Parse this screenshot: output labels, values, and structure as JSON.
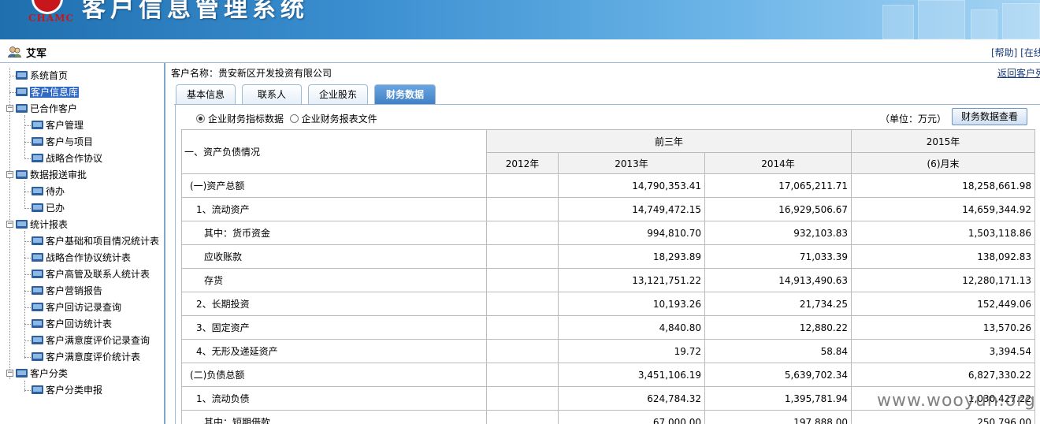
{
  "header": {
    "logo_text": "CHAMC",
    "system_title": "客户信息管理系统"
  },
  "userbar": {
    "user_name": "艾军",
    "links_text": "[帮助] [在线"
  },
  "sidebar": {
    "items": [
      {
        "label": "系统首页"
      },
      {
        "label": "客户信息库"
      },
      {
        "label": "已合作客户"
      },
      {
        "label": "客户管理"
      },
      {
        "label": "客户与项目"
      },
      {
        "label": "战略合作协议"
      },
      {
        "label": "数据报送审批"
      },
      {
        "label": "待办"
      },
      {
        "label": "已办"
      },
      {
        "label": "统计报表"
      },
      {
        "label": "客户基础和项目情况统计表"
      },
      {
        "label": "战略合作协议统计表"
      },
      {
        "label": "客户高管及联系人统计表"
      },
      {
        "label": "客户营销报告"
      },
      {
        "label": "客户回访记录查询"
      },
      {
        "label": "客户回访统计表"
      },
      {
        "label": "客户满意度评价记录查询"
      },
      {
        "label": "客户满意度评价统计表"
      },
      {
        "label": "客户分类"
      },
      {
        "label": "客户分类申报"
      }
    ]
  },
  "main": {
    "customer_label": "客户名称：贵安新区开发投资有限公司",
    "back_link": "返回客户列",
    "tabs": [
      {
        "label": "基本信息"
      },
      {
        "label": "联系人"
      },
      {
        "label": "企业股东"
      },
      {
        "label": "财务数据"
      }
    ],
    "radios": [
      {
        "label": "企业财务指标数据",
        "checked": true
      },
      {
        "label": "企业财务报表文件",
        "checked": false
      }
    ],
    "unit_text": "（单位：万元）",
    "view_button": "财务数据查看",
    "table": {
      "row_header": "一、资产负债情况",
      "group_prev": "前三年",
      "group_cur": "2015年",
      "years": [
        "2012年",
        "2013年",
        "2014年",
        "(6)月末"
      ],
      "rows": [
        {
          "label": "(一)资产总额",
          "v2012": "",
          "v2013": "14,790,353.41",
          "v2014": "17,065,211.71",
          "v2015": "18,258,661.98"
        },
        {
          "label": "1、流动资产",
          "v2012": "",
          "v2013": "14,749,472.15",
          "v2014": "16,929,506.67",
          "v2015": "14,659,344.92"
        },
        {
          "label": "其中：货币资金",
          "v2012": "",
          "v2013": "994,810.70",
          "v2014": "932,103.83",
          "v2015": "1,503,118.86"
        },
        {
          "label": "应收账款",
          "v2012": "",
          "v2013": "18,293.89",
          "v2014": "71,033.39",
          "v2015": "138,092.83"
        },
        {
          "label": "存货",
          "v2012": "",
          "v2013": "13,121,751.22",
          "v2014": "14,913,490.63",
          "v2015": "12,280,171.13"
        },
        {
          "label": "2、长期投资",
          "v2012": "",
          "v2013": "10,193.26",
          "v2014": "21,734.25",
          "v2015": "152,449.06"
        },
        {
          "label": "3、固定资产",
          "v2012": "",
          "v2013": "4,840.80",
          "v2014": "12,880.22",
          "v2015": "13,570.26"
        },
        {
          "label": "4、无形及递延资产",
          "v2012": "",
          "v2013": "19.72",
          "v2014": "58.84",
          "v2015": "3,394.54"
        },
        {
          "label": "(二)负债总额",
          "v2012": "",
          "v2013": "3,451,106.19",
          "v2014": "5,639,702.34",
          "v2015": "6,827,330.22"
        },
        {
          "label": "1、流动负债",
          "v2012": "",
          "v2013": "624,784.32",
          "v2014": "1,395,781.94",
          "v2015": "1,030,427.22"
        },
        {
          "label": "其中：短期借款",
          "v2012": "",
          "v2013": "67,000.00",
          "v2014": "197,888.00",
          "v2015": "250,796.00"
        }
      ]
    }
  },
  "watermark": "www.wooyun.org"
}
